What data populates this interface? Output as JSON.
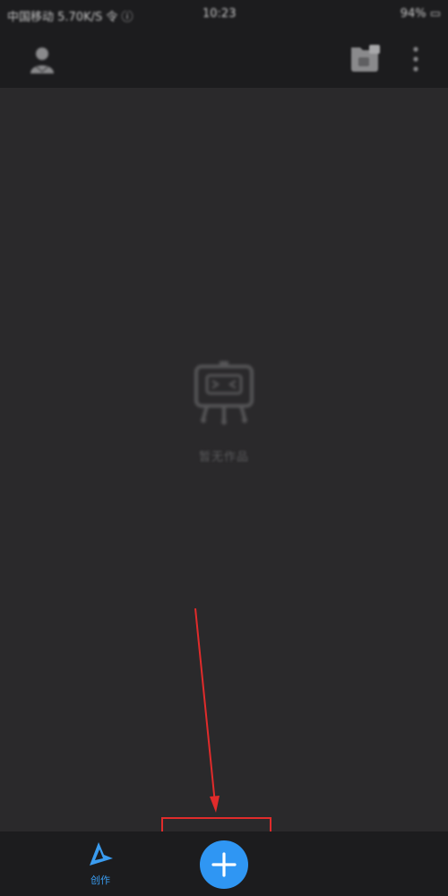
{
  "status_bar": {
    "carrier": "中国移动 5.70K/S 令 ⓘ",
    "time": "10:23",
    "battery": "94% ▭"
  },
  "top_bar": {
    "avatar_icon": "user-avatar-icon",
    "folder_icon": "folder-icon",
    "more_icon": "more-vertical-icon"
  },
  "empty_state": {
    "illustration": "empty-robot-icon",
    "text": "暂无作品"
  },
  "bottom_nav": {
    "create": {
      "label": "创作",
      "icon": "create-icon",
      "color": "#3a9cf0"
    },
    "add_button": {
      "icon": "plus-icon",
      "color": "#2f96f3"
    }
  },
  "annotation": {
    "color": "#e02b2b"
  }
}
